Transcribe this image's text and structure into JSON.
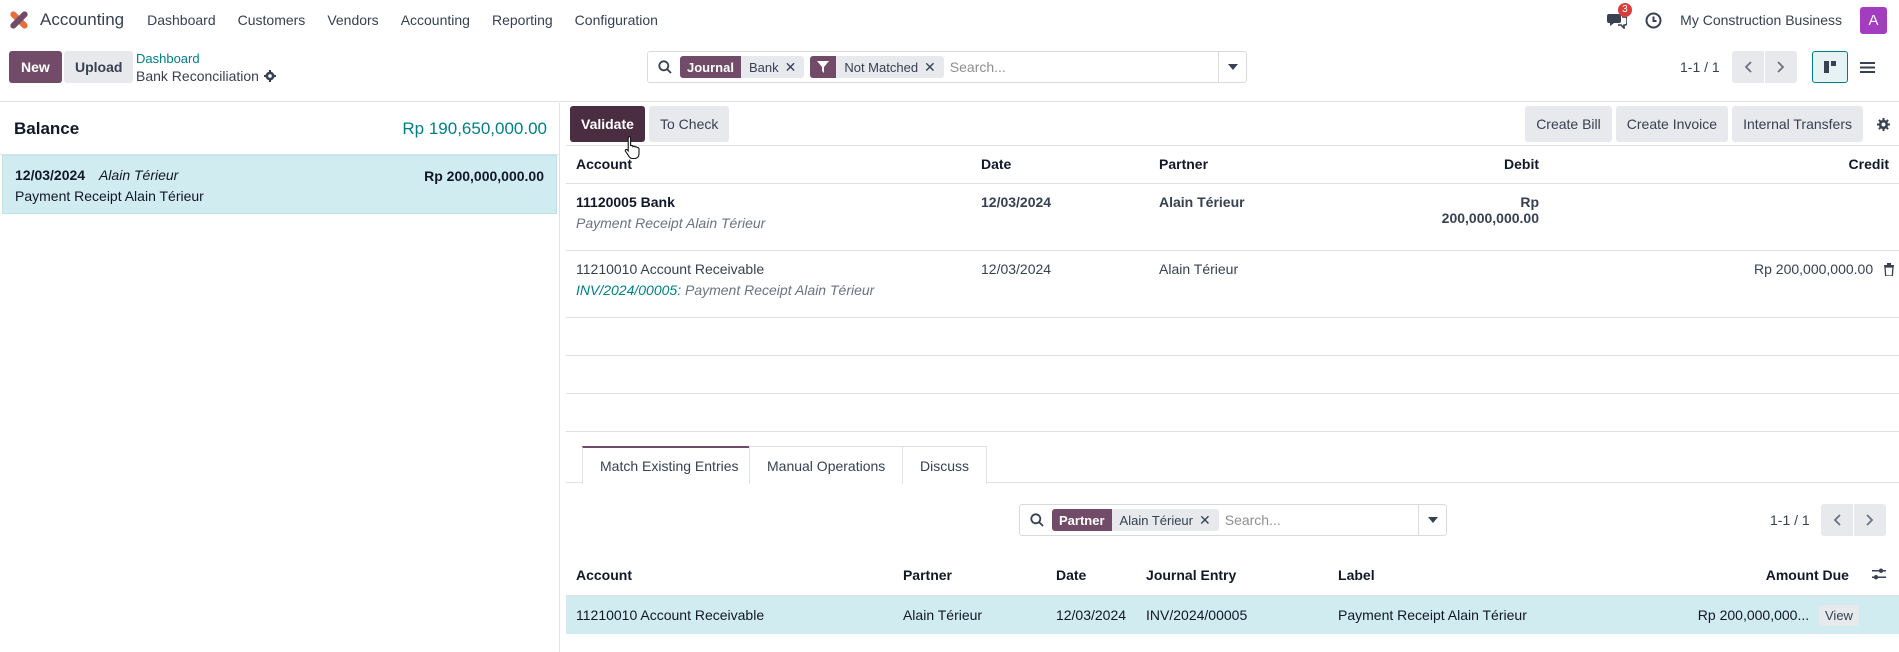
{
  "nav": {
    "app_name": "Accounting",
    "menu": [
      "Dashboard",
      "Customers",
      "Vendors",
      "Accounting",
      "Reporting",
      "Configuration"
    ],
    "message_count": "3",
    "company": "My Construction Business",
    "avatar_letter": "A"
  },
  "control": {
    "new_label": "New",
    "upload_label": "Upload",
    "breadcrumb_parent": "Dashboard",
    "breadcrumb_current": "Bank Reconciliation",
    "facets": [
      {
        "label": "Journal",
        "value": "Bank"
      },
      {
        "label": "filter-icon",
        "value": "Not Matched"
      }
    ],
    "search_placeholder": "Search...",
    "pager": "1-1 / 1"
  },
  "left": {
    "balance_label": "Balance",
    "balance_value": "Rp 190,650,000.00",
    "statement": {
      "date": "12/03/2024",
      "partner": "Alain Térieur",
      "amount": "Rp 200,000,000.00",
      "label": "Payment Receipt Alain Térieur"
    }
  },
  "toolbar": {
    "validate": "Validate",
    "to_check": "To Check",
    "create_bill": "Create Bill",
    "create_invoice": "Create Invoice",
    "internal_transfers": "Internal Transfers"
  },
  "lines": {
    "headers": {
      "account": "Account",
      "date": "Date",
      "partner": "Partner",
      "debit": "Debit",
      "credit": "Credit"
    },
    "rows": [
      {
        "account": "11120005 Bank",
        "sub_ref": "",
        "sub": "Payment Receipt Alain Térieur",
        "date": "12/03/2024",
        "partner": "Alain Térieur",
        "debit": "Rp 200,000,000.00",
        "credit": ""
      },
      {
        "account": "11210010 Account Receivable",
        "sub_ref": "INV/2024/00005:",
        "sub": " Payment Receipt Alain Térieur",
        "date": "12/03/2024",
        "partner": "Alain Térieur",
        "debit": "",
        "credit": "Rp 200,000,000.00"
      }
    ]
  },
  "tabs": [
    "Match Existing Entries",
    "Manual Operations",
    "Discuss"
  ],
  "match": {
    "facet_label": "Partner",
    "facet_value": "Alain Térieur",
    "search_placeholder": "Search...",
    "pager": "1-1 / 1",
    "headers": {
      "account": "Account",
      "partner": "Partner",
      "date": "Date",
      "journal_entry": "Journal Entry",
      "label": "Label",
      "amount_due": "Amount Due"
    },
    "row": {
      "account": "11210010 Account Receivable",
      "partner": "Alain Térieur",
      "date": "12/03/2024",
      "journal_entry": "INV/2024/00005",
      "label": "Payment Receipt Alain Térieur",
      "amount_due": "Rp 200,000,000...",
      "view": "View"
    }
  },
  "colors": {
    "brand": "#714b67",
    "teal": "#017e84",
    "selected_row": "#d1ecf1"
  }
}
